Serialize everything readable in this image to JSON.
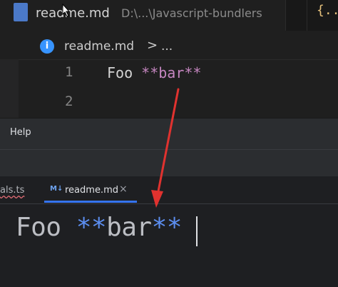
{
  "top_editor": {
    "tab": {
      "title": "readme.md",
      "path": "D:\\...\\Javascript-bundlers",
      "right_icon_text": "{..."
    },
    "breadcrumb": {
      "info_glyph": "i",
      "file": "readme.md",
      "separator": ">",
      "more": "..."
    },
    "lines": [
      {
        "number": "1",
        "text_plain": "Foo ",
        "text_bold": "**bar**"
      },
      {
        "number": "2",
        "text_plain": "",
        "text_bold": ""
      }
    ]
  },
  "menubar": {
    "help_label": "Help"
  },
  "bottom_editor": {
    "tabs": [
      {
        "label": "als.ts"
      },
      {
        "icon_text": "M↓",
        "label": "readme.md",
        "close": "×"
      }
    ],
    "code": {
      "plain": "Foo ",
      "mark_open": "**",
      "word": "bar",
      "mark_close": "**"
    }
  },
  "colors": {
    "arrow": "#e0322f",
    "bold_markdown": "#c586c0",
    "markdown_marks": "#5c8ef0",
    "accent": "#3574f0"
  },
  "icons": {
    "markdown": "markdown-icon",
    "info": "info-icon",
    "json_braces": "json-braces-icon"
  }
}
